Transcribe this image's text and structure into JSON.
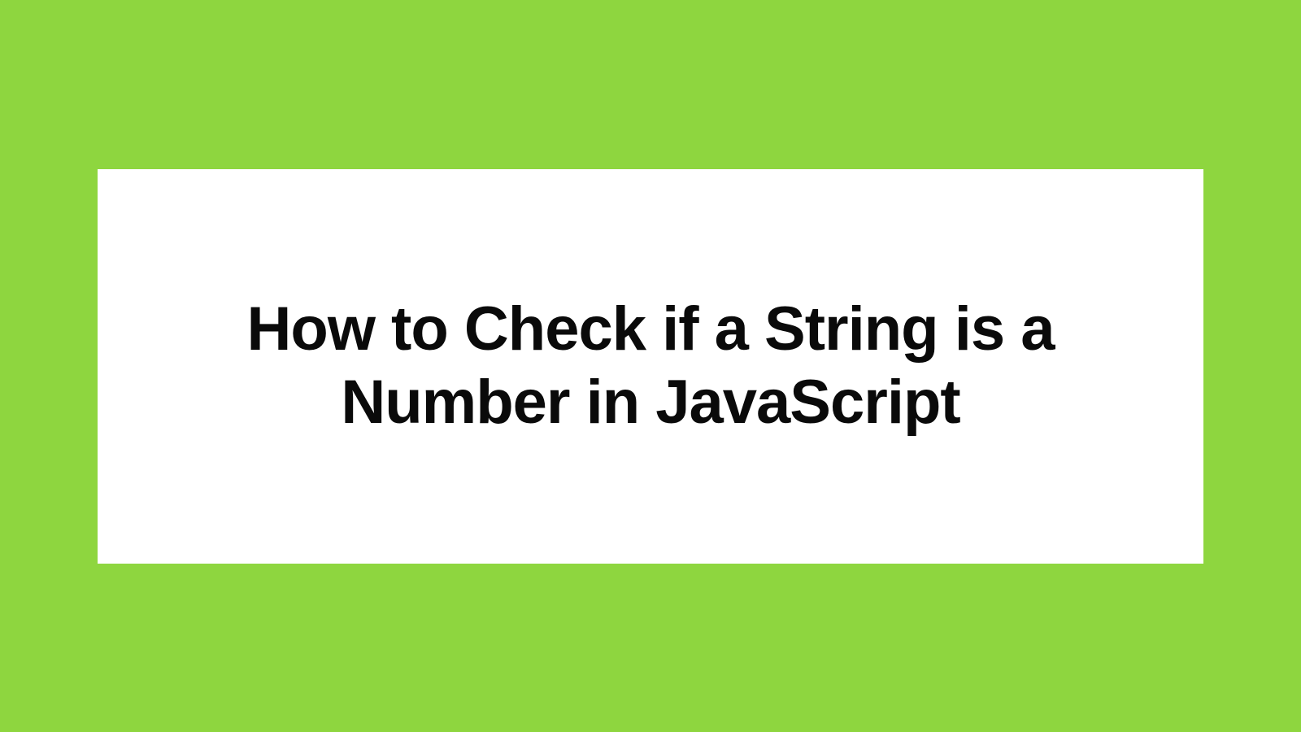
{
  "card": {
    "title": "How to Check if a String is a Number in JavaScript"
  },
  "colors": {
    "background": "#8ed63f",
    "card_background": "#ffffff",
    "text": "#0a0a0a"
  }
}
